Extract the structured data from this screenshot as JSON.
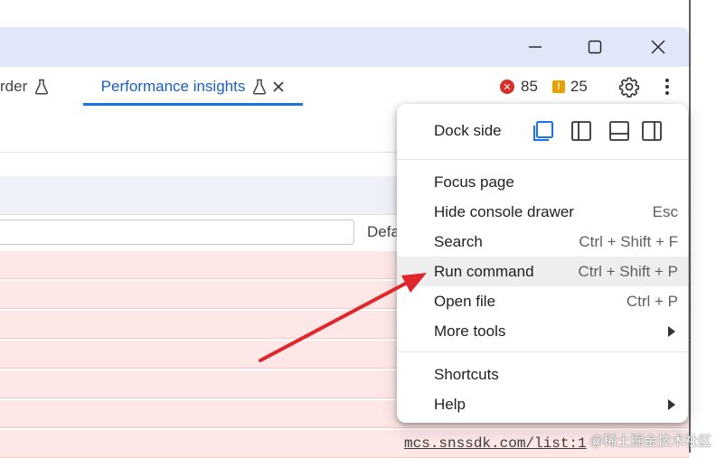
{
  "window": {
    "controls": [
      "minimize",
      "maximize",
      "close"
    ]
  },
  "tabs": {
    "partial_label": "rder",
    "active_label": "Performance insights"
  },
  "counters": {
    "errors": "85",
    "warnings": "25"
  },
  "filter": {
    "default_levels_partial": "Defa"
  },
  "menu": {
    "dock_label": "Dock side",
    "items": [
      {
        "label": "Focus page",
        "shortcut": ""
      },
      {
        "label": "Hide console drawer",
        "shortcut": "Esc"
      },
      {
        "label": "Search",
        "shortcut": "Ctrl + Shift + F"
      },
      {
        "label": "Run command",
        "shortcut": "Ctrl + Shift + P"
      },
      {
        "label": "Open file",
        "shortcut": "Ctrl + P"
      },
      {
        "label": "More tools",
        "shortcut": ""
      },
      {
        "label": "Shortcuts",
        "shortcut": ""
      },
      {
        "label": "Help",
        "shortcut": ""
      }
    ]
  },
  "console": {
    "link": "mcs.snssdk.com/list:1"
  },
  "watermark": "@稀土掘金技术社区",
  "colors": {
    "accent": "#1a73e8",
    "error": "#d93025",
    "warning": "#e8a100",
    "annotation_arrow": "#e0262b",
    "error_row": "#fde7e7"
  }
}
